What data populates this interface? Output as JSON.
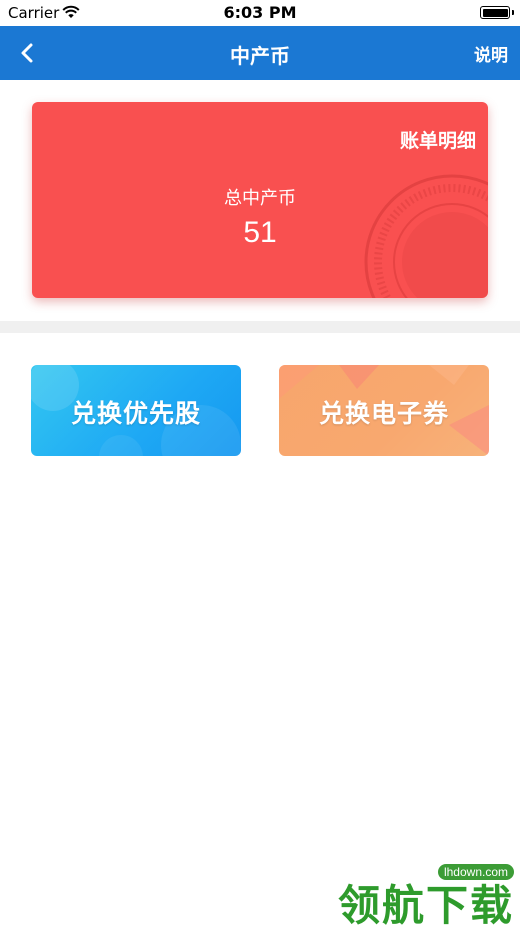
{
  "status_bar": {
    "carrier": "Carrier",
    "time": "6:03 PM"
  },
  "nav": {
    "title": "中产币",
    "help_label": "说明",
    "bar_color": "#1b78d3"
  },
  "balance_card": {
    "bill_link": "账单明细",
    "total_label": "总中产币",
    "total_value": "51",
    "card_color": "#f95050"
  },
  "actions": {
    "exchange_stock": "兑换优先股",
    "exchange_coupon": "兑换电子券"
  },
  "watermark": {
    "site": "lhdown.com",
    "text": "领航下载"
  }
}
